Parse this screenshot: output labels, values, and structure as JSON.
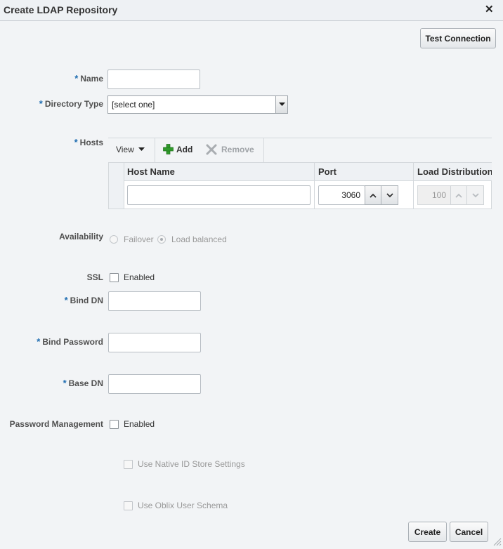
{
  "dialog": {
    "title": "Create LDAP Repository",
    "close_icon": "close-icon"
  },
  "toolbar": {
    "test_connection_label": "Test Connection"
  },
  "form": {
    "name": {
      "label": "Name",
      "required": "*",
      "value": ""
    },
    "directory_type": {
      "label": "Directory Type",
      "required": "*",
      "selected": "[select one]"
    },
    "hosts": {
      "label": "Hosts",
      "required": "*",
      "view_label": "View",
      "add_label": "Add",
      "remove_label": "Remove",
      "columns": [
        "Host Name",
        "Port",
        "Load Distribution"
      ],
      "rows": [
        {
          "host_name": "",
          "port": "3060",
          "load_distribution": "100"
        }
      ]
    },
    "availability": {
      "label": "Availability",
      "options": [
        "Failover",
        "Load balanced"
      ],
      "selected": "Load balanced"
    },
    "ssl": {
      "label": "SSL",
      "option": "Enabled",
      "checked": false
    },
    "bind_dn": {
      "label": "Bind DN",
      "required": "*",
      "value": ""
    },
    "bind_password": {
      "label": "Bind Password",
      "required": "*",
      "value": ""
    },
    "base_dn": {
      "label": "Base DN",
      "required": "*",
      "value": ""
    },
    "password_management": {
      "label": "Password Management",
      "option": "Enabled",
      "checked": false
    },
    "native_id_store": {
      "label": "Use Native ID Store Settings",
      "checked": false
    },
    "oblix_schema": {
      "label": "Use Oblix User Schema",
      "checked": false
    }
  },
  "footer": {
    "create_label": "Create",
    "cancel_label": "Cancel"
  },
  "colors": {
    "required_marker": "#1f6db1",
    "add_icon": "#2f9a2b"
  }
}
